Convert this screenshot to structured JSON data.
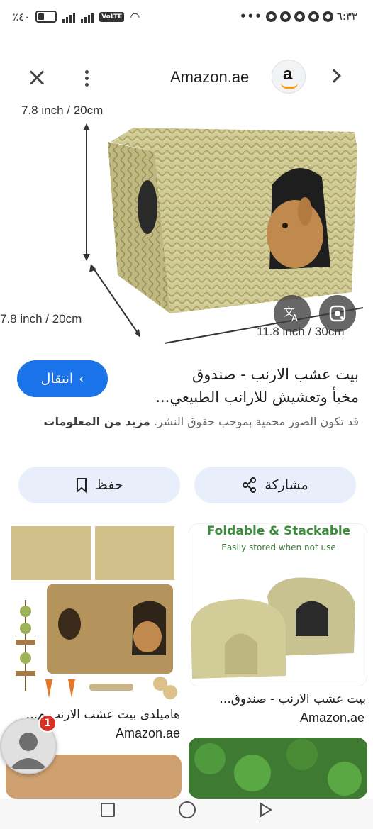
{
  "status_bar": {
    "battery": "٪٤٠",
    "time": "٦:٣٣",
    "volte": "VoLTE",
    "notification_icons": [
      "app-icon",
      "app-icon",
      "app-icon",
      "app-icon",
      "app-icon"
    ]
  },
  "header": {
    "site_name": "Amazon.ae",
    "logo_letter": "a"
  },
  "hero": {
    "dim_height": "7.8 inch / 20cm",
    "dim_depth": "7.8 inch / 20cm",
    "dim_width": "11.8 inch / 30cm",
    "translate_icon": "translate-icon",
    "lens_icon": "google-lens-icon"
  },
  "result": {
    "title_line1": "بيت عشب الارنب - صندوق",
    "title_line2": "مخبأ وتعشيش للارانب الطبيعي...",
    "visit_label": "انتقال",
    "copyright_text": "قد تكون الصور محمية بموجب حقوق النشر.",
    "learn_more": "مزيد من المعلومات"
  },
  "actions": {
    "share_label": "مشاركة",
    "save_label": "حفظ"
  },
  "grid": {
    "right_card": {
      "headline": "Foldable & Stackable",
      "subheadline": "Easily stored when not use",
      "caption": "بيت عشب الارنب - صندوق...",
      "source": "Amazon.ae"
    },
    "left_card": {
      "caption": "هاميلدى بيت عشب الارنب م...",
      "source": "Amazon.ae"
    }
  },
  "profile_badge": {
    "count": "1"
  },
  "colors": {
    "accent": "#1a73e8",
    "pill": "#e8effa",
    "badge": "#d93025",
    "straw": "#c9c48a"
  }
}
